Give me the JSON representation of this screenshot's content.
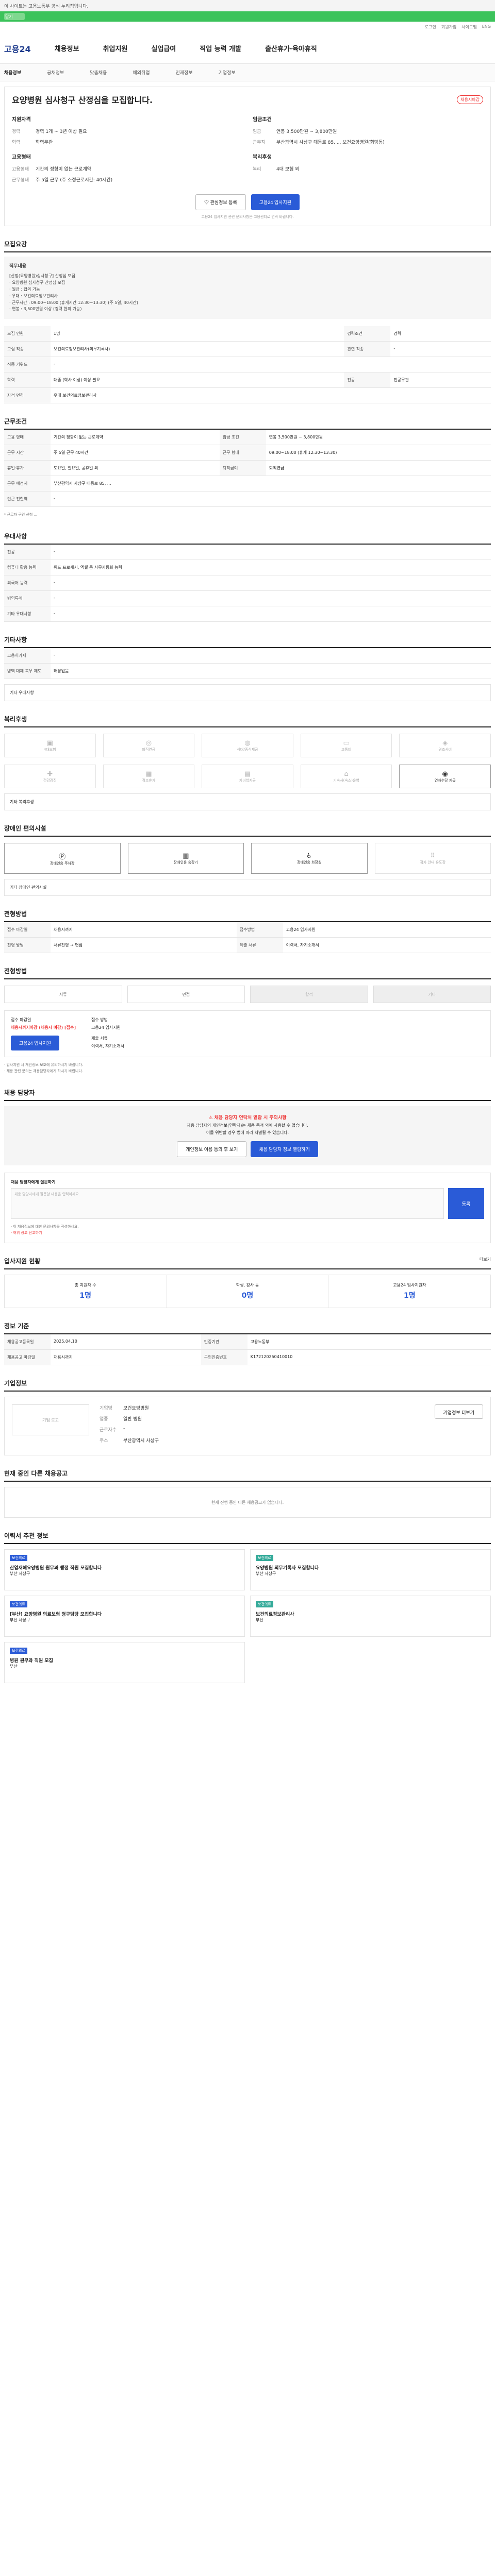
{
  "top": {
    "notice": "이 사이트는 고용노동부 공식 누리집입니다.",
    "green": "닫기",
    "util": [
      "로그인",
      "회원가입",
      "사이트맵",
      "ENG"
    ]
  },
  "header": {
    "logo": "고용24",
    "menu": [
      "채용정보",
      "취업지원",
      "실업급여",
      "직업 능력 개발",
      "출산휴가·육아휴직"
    ]
  },
  "subnav": [
    "채용정보",
    "공채정보",
    "맞춤채용",
    "해외취업",
    "인재정보",
    "기업정보"
  ],
  "job": {
    "title": "요양병원 심사청구 산정심을 모집합니다.",
    "badge": "채용시마감",
    "left_title": "지원자격",
    "left_items": [
      [
        "경력",
        "경력 1개 ~ 3년 이상 필요"
      ],
      [
        "학력",
        "학력무관"
      ]
    ],
    "left_title2": "고용형태",
    "left_items2": [
      [
        "고용형태",
        "기간의 정함이 없는 근로계약"
      ],
      [
        "근무형태",
        "주 5일 근무 (주 소정근로시간: 40시간)"
      ]
    ],
    "right_title": "임금조건",
    "right_items": [
      [
        "임금",
        "연봉 3,500만원 ~ 3,800만원"
      ],
      [
        "근무지",
        "부산광역시 사상구 대동로 85, ... 보건요양병원(희망동)"
      ]
    ],
    "right_title2": "복리후생",
    "right_items2": [
      [
        "복리",
        "4대 보험 외"
      ]
    ],
    "btn_fav": "관심정보 등록",
    "btn_apply": "고용24 입사지원",
    "note": "고용24 입사지원 관련 문의사항은 고용센터로 연락 바랍니다."
  },
  "summary": {
    "title": "모집요강",
    "box_title": "직무내용",
    "lines": [
      "[산정(요양병원)심사청구] 산정심 모집",
      "· 요양병원 심사청구 산정심 모집",
      "· 월급 : 협의 가능",
      "· 우대 : 보건의료정보관리사",
      "· 근무시간 : 09:00~18:00 (휴게시간 12:30~13:30) (주 5일, 40시간)",
      "· 연봉 : 3,500만원 이상 (경력 협의 가능)"
    ],
    "rows": [
      [
        "모집 인원",
        "1명",
        "경력조건",
        "경력"
      ],
      [
        "모집 직종",
        "보건의료정보관리사(의무기록사)",
        "관련 직종",
        "-"
      ],
      [
        "직종 키워드",
        "-",
        "",
        ""
      ],
      [
        "학력",
        "대졸 (학사 이상) 이상 필요",
        "전공",
        "전공무관"
      ],
      [
        "자격 면허",
        "우대 보건의료정보관리사",
        "",
        ""
      ]
    ]
  },
  "work": {
    "title": "근무조건",
    "rows": [
      [
        "고용 형태",
        "기간의 정함이 없는 근로계약",
        "임금 조건",
        "연봉 3,500만원 ~ 3,800만원"
      ],
      [
        "근무 시간",
        "주 5일 근무 40시간",
        "근무 형태",
        "09:00~18:00 (휴게 12:30~13:30)"
      ],
      [
        "휴일·휴가",
        "토요일, 일요일, 공휴일 외",
        "퇴직급여",
        "퇴직연금"
      ],
      [
        "근무 예정지",
        "부산광역시 사상구 대동로 85, ...",
        "",
        ""
      ],
      [
        "인근 전철역",
        "-",
        "",
        ""
      ]
    ],
    "note": "* 근로자 구인 신청 ..."
  },
  "pref": {
    "title": "우대사항",
    "rows": [
      [
        "전공",
        "-"
      ],
      [
        "컴퓨터 활용 능력",
        "워드 프로세서, 엑셀 등 사무자동화 능력"
      ],
      [
        "외국어 능력",
        "-"
      ],
      [
        "병역특례",
        "-"
      ],
      [
        "기타 우대사항",
        "-"
      ]
    ]
  },
  "etc": {
    "title": "기타사항",
    "rows": [
      [
        "고용허가제",
        "-"
      ],
      [
        "병역 대체 복무 제도",
        "해당없음"
      ]
    ],
    "extra": "기타 우대사항"
  },
  "benefit": {
    "title": "복리후생",
    "items": [
      "4대보험",
      "퇴직연금",
      "식대/중식제공",
      "교통비",
      "경조사비",
      "건강검진",
      "경조휴가",
      "자녀학자금",
      "기숙사(숙소)운영",
      "연차수당 지급"
    ],
    "box": "기타 복리후생"
  },
  "disabled": {
    "title": "장애인 편의시설",
    "items": [
      "장애인용 주차장",
      "장애인용 승강기",
      "장애인용 화장실",
      "점자 안내 유도장"
    ],
    "box": "기타 장애인 편의시설"
  },
  "process": {
    "title": "전형방법",
    "rows": [
      [
        "접수 마감일",
        "채용시까지",
        "접수방법",
        "고용24 입사지원"
      ],
      [
        "전형 방법",
        "서류전형 → 면접",
        "제출 서류",
        "이력서, 자기소개서"
      ]
    ]
  },
  "apply": {
    "title": "전형방법",
    "steps": [
      "서류",
      "면접",
      "합격",
      "기타"
    ],
    "deadline_label": "접수 마감일",
    "deadline": "채용시까지마감 (채용시 마감) [접수]",
    "method_label": "접수 방법",
    "method": "고용24 입사지원",
    "apply_btn": "고용24 입사지원",
    "doc_label": "제출 서류",
    "doc": "이력서, 자기소개서",
    "notes": [
      "· 입사지원 시 개인정보 보호에 유의하시기 바랍니다.",
      "· 채용 관련 문의는 채용담당자에게 하시기 바랍니다."
    ]
  },
  "manager": {
    "title": "채용 담당자",
    "warn": "채용 담당자 연락처 열람 시 주의사항",
    "lines": [
      "채용 담당자의 개인정보(연락처)는 채용 목적 외에 사용할 수 없습니다.",
      "이를 위반할 경우 법에 따라 처벌될 수 있습니다."
    ],
    "btn1": "개인정보 이용 동의 후 보기",
    "btn2": "채용 담당자 정보 열람하기"
  },
  "qna": {
    "title": "채용 담당자에게 질문하기",
    "placeholder": "채용 담당자에게 질문할 내용을 입력하세요.",
    "btn": "등록",
    "notes": [
      "· 이 채용정보에 대한 문의사항을 작성하세요.",
      "· 허위 광고 신고하기"
    ]
  },
  "stats": {
    "title": "입사지원 현황",
    "more": "더보기",
    "items": [
      [
        "총 지원자 수",
        "1명"
      ],
      [
        "학생, 강사 등",
        "0명"
      ],
      [
        "고용24 입사지원자",
        "1명"
      ]
    ]
  },
  "info": {
    "title": "정보 기준",
    "rows": [
      [
        "채용공고등록일",
        "2025.04.10",
        "인증기관",
        "고용노동부"
      ],
      [
        "채용공고 마감일",
        "채용시까지",
        "구인인증번호",
        "K172120250410010"
      ]
    ]
  },
  "company": {
    "title": "기업정보",
    "logo": "기업 로고",
    "rows": [
      [
        "기업명",
        "보건요양병원"
      ],
      [
        "업종",
        "일반 병원"
      ],
      [
        "근로자수",
        "-"
      ],
      [
        "주소",
        "부산광역시 사상구"
      ]
    ],
    "btn": "기업정보 더보기"
  },
  "others": {
    "title": "현재 중인 다른 채용공고",
    "empty": "현재 진행 중인 다른 채용공고가 없습니다."
  },
  "recommend": {
    "title": "이력서 추천 정보",
    "cards": [
      {
        "tag": "보건의료",
        "text": "산업재해요양병원 원무과 행정 직원 모집합니다",
        "sub": "부산 사상구"
      },
      {
        "tag": "보건의료",
        "text": "요양병원 의무기록사 모집합니다",
        "sub": "부산 사상구"
      },
      {
        "tag": "보건의료",
        "text": "[부산] 요양병원 의료보험 청구담당 모집합니다",
        "sub": "부산 사상구"
      },
      {
        "tag": "보건의료",
        "text": "보건의료정보관리사",
        "sub": "부산"
      },
      {
        "tag": "보건의료",
        "text": "병원 원무과 직원 모집",
        "sub": "부산"
      }
    ]
  }
}
